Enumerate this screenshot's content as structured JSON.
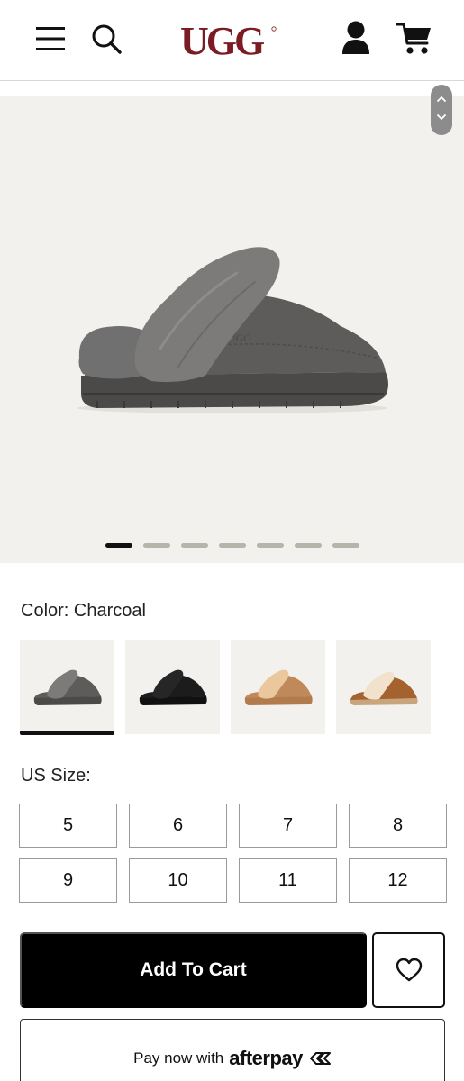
{
  "header": {
    "logo_text": "UGG",
    "icons": [
      "menu-icon",
      "search-icon",
      "account-icon",
      "cart-icon"
    ]
  },
  "gallery": {
    "image_count": 7,
    "active_index": 0,
    "background": "#f2f1ed"
  },
  "color": {
    "label": "Color: Charcoal",
    "swatches": [
      {
        "name": "Charcoal",
        "hex": "#5b5a58",
        "selected": true
      },
      {
        "name": "Black",
        "hex": "#121212",
        "selected": false
      },
      {
        "name": "Chestnut / Sand",
        "hex": "#c89366",
        "selected": false
      },
      {
        "name": "Chestnut",
        "hex": "#a86a3c",
        "selected": false
      }
    ]
  },
  "size": {
    "label": "US Size:",
    "options": [
      "5",
      "6",
      "7",
      "8",
      "9",
      "10",
      "11",
      "12"
    ]
  },
  "actions": {
    "add_to_cart": "Add To Cart",
    "wishlist_icon": "heart-icon"
  },
  "payment": {
    "text": "Pay now with",
    "brand": "afterpay"
  },
  "colors": {
    "brand": "#7b1c24",
    "primary_button": "#000000",
    "active_dot": "#111111",
    "inactive_dot": "#b7b4ac"
  }
}
